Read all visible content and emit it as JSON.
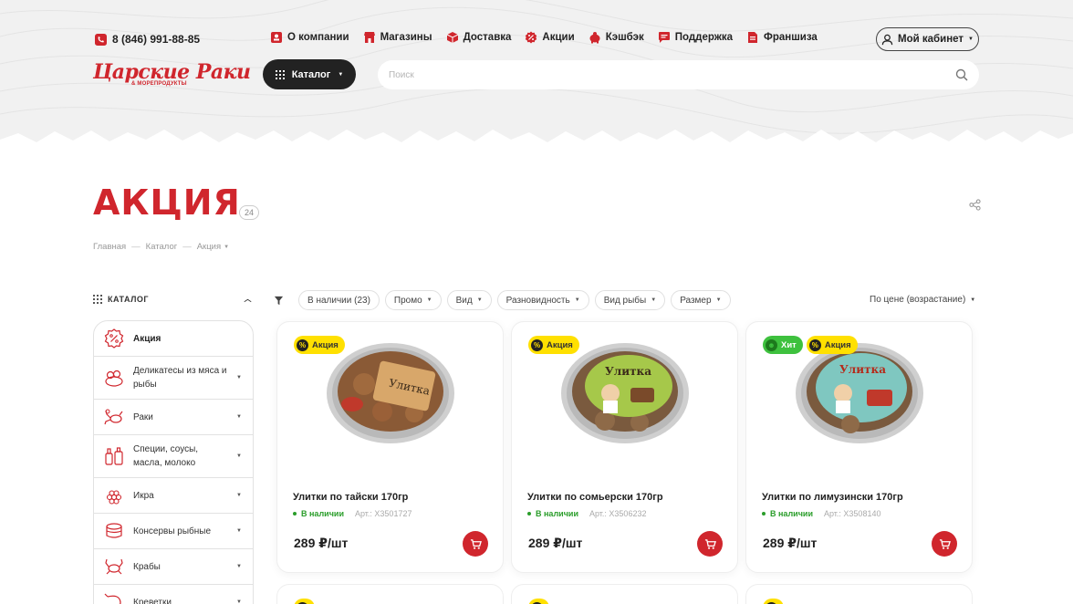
{
  "header": {
    "phone": "8 (846) 991-88-85",
    "logo_main": "Царские Раки",
    "logo_sub": "& МОРЕПРОДУКТЫ",
    "nav": [
      {
        "label": "О компании",
        "icon": "info-icon"
      },
      {
        "label": "Магазины",
        "icon": "store-icon"
      },
      {
        "label": "Доставка",
        "icon": "box-icon"
      },
      {
        "label": "Акции",
        "icon": "percent-icon"
      },
      {
        "label": "Кэшбэк",
        "icon": "piggy-bank-icon"
      },
      {
        "label": "Поддержка",
        "icon": "chat-icon"
      },
      {
        "label": "Франшиза",
        "icon": "document-icon"
      }
    ],
    "cabinet_label": "Мой кабинет",
    "catalog_label": "Каталог",
    "search_placeholder": "Поиск"
  },
  "page": {
    "title": "АКЦИЯ",
    "count": "24",
    "breadcrumbs": [
      "Главная",
      "Каталог",
      "Акция"
    ]
  },
  "sidebar": {
    "heading": "КАТАЛОГ",
    "items": [
      {
        "label": "Акция",
        "icon": "percent-shell-icon",
        "active": true
      },
      {
        "label": "Деликатесы из мяса и рыбы",
        "icon": "deli-icon"
      },
      {
        "label": "Раки",
        "icon": "crayfish-icon"
      },
      {
        "label": "Специи, соусы, масла, молоко",
        "icon": "bottles-icon"
      },
      {
        "label": "Икра",
        "icon": "caviar-icon"
      },
      {
        "label": "Консервы рыбные",
        "icon": "cans-icon"
      },
      {
        "label": "Крабы",
        "icon": "crab-icon"
      },
      {
        "label": "Креветки",
        "icon": "shrimp-icon"
      }
    ]
  },
  "filters": {
    "chips": [
      "В наличии (23)",
      "Промо",
      "Вид",
      "Разновидность",
      "Вид рыбы",
      "Размер"
    ],
    "sort_label": "По цене (возрастание)"
  },
  "products": [
    {
      "name": "Улитки по тайски 170гр",
      "stock": "В наличии",
      "article": "Арт.: Х3501727",
      "price": "289 ₽/шт",
      "badges": [
        "Акция"
      ],
      "label_color": "#c98a4a"
    },
    {
      "name": "Улитки по сомьерски 170гр",
      "stock": "В наличии",
      "article": "Арт.: Х3506232",
      "price": "289 ₽/шт",
      "badges": [
        "Акция"
      ],
      "label_color": "#a6c84a"
    },
    {
      "name": "Улитки по лимузински 170гр",
      "stock": "В наличии",
      "article": "Арт.: Х3508140",
      "price": "289 ₽/шт",
      "badges": [
        "Хит",
        "Акция"
      ],
      "label_color": "#7fc7c0"
    }
  ],
  "badges": {
    "promo": "Акция",
    "hit": "Хит"
  },
  "colors": {
    "brand_red": "#d0262d",
    "promo_yellow": "#ffe000",
    "hit_green": "#3ec13e",
    "stock_green": "#2a9d2a"
  }
}
